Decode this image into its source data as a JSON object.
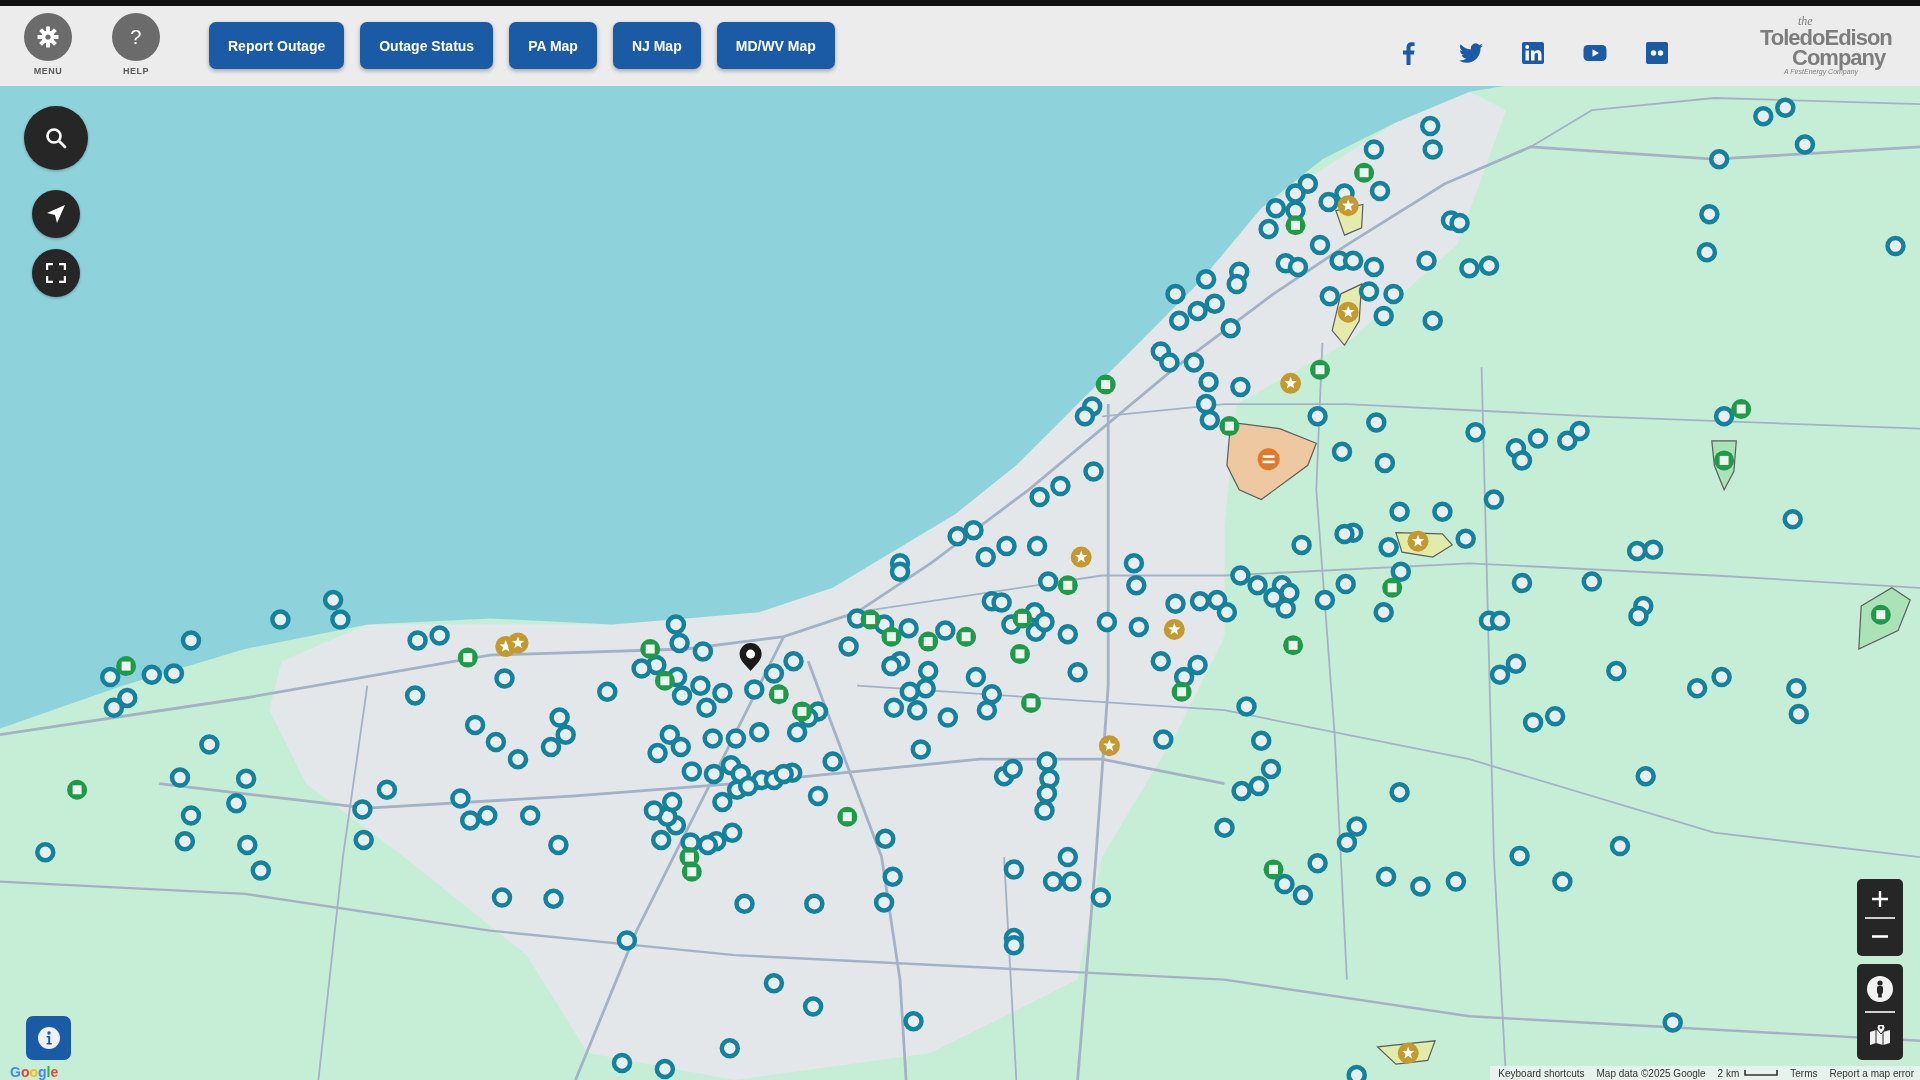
{
  "header": {
    "menu": {
      "label": "MENU"
    },
    "help": {
      "glyph": "?",
      "label": "HELP"
    },
    "nav_buttons": [
      "Report Outage",
      "Outage Status",
      "PA Map",
      "NJ Map",
      "MD/WV Map"
    ],
    "social_links": [
      {
        "kind": "facebook"
      },
      {
        "kind": "twitter"
      },
      {
        "kind": "linkedin"
      },
      {
        "kind": "youtube"
      },
      {
        "kind": "flickr"
      }
    ],
    "logo": {
      "prefix": "the",
      "name": "ToledoEdison",
      "suffix": "Company",
      "tagline": "A FirstEnergy Company"
    }
  },
  "map": {
    "google_logo": "Google",
    "attribution": {
      "shortcuts": "Keyboard shortcuts",
      "map_data": "Map data ©2025 Google",
      "scale": "2 km",
      "terms": "Terms",
      "report": "Report a map error"
    }
  }
}
